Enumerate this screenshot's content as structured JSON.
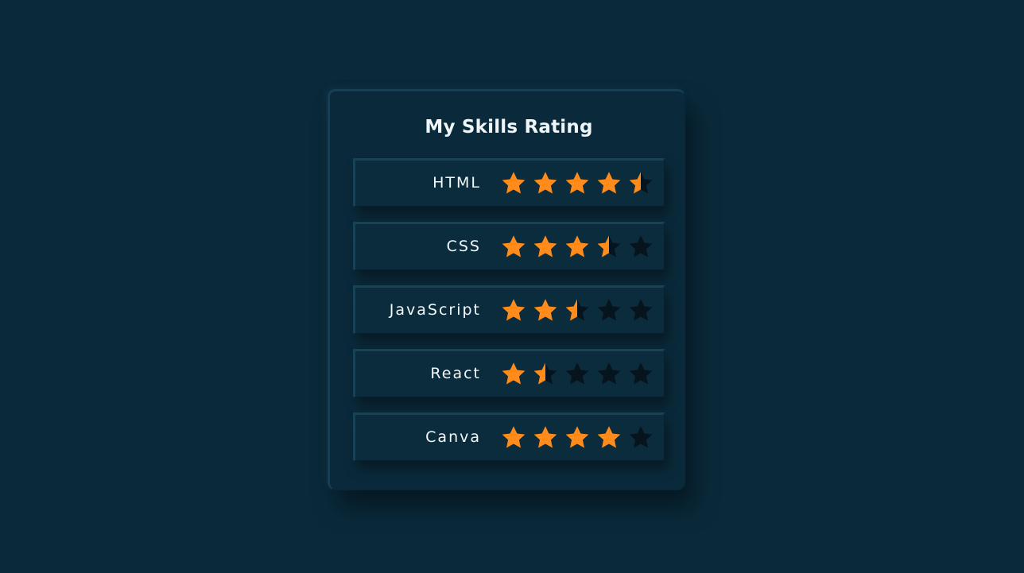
{
  "page": {
    "title": "My Skills Rating"
  },
  "colors": {
    "background": "#0a2a3b",
    "star_filled": "#ff8c1a",
    "star_empty": "#06141d",
    "text": "#f3f8fb"
  },
  "icons": {
    "star": "star-icon"
  },
  "max_stars": 5,
  "skills": [
    {
      "name": "HTML",
      "rating": 4.5
    },
    {
      "name": "CSS",
      "rating": 3.5
    },
    {
      "name": "JavaScript",
      "rating": 2.5
    },
    {
      "name": "React",
      "rating": 1.5
    },
    {
      "name": "Canva",
      "rating": 4
    }
  ]
}
